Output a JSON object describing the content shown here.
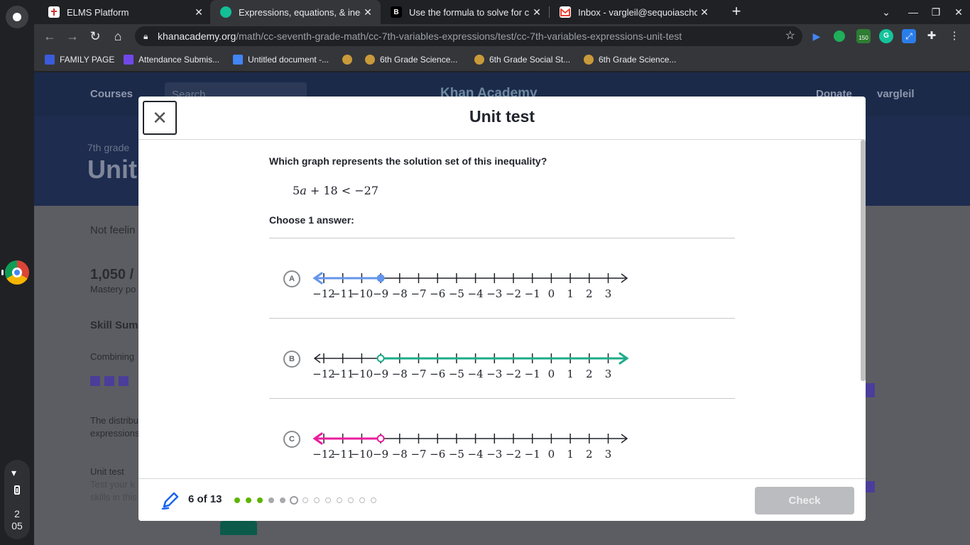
{
  "browser": {
    "tabs": [
      {
        "title": "ELMS Platform",
        "favicon_color": "#ffffff"
      },
      {
        "title": "Expressions, equations, & inequa",
        "favicon_color": "#14bf96"
      },
      {
        "title": "Use the formula to solve for c. Ch",
        "favicon_color": "#000000"
      },
      {
        "title": "Inbox - vargleil@sequoiaschools.",
        "favicon_color": "#ea4335"
      }
    ],
    "new_tab_label": "+",
    "url_host": "khanacademy.org",
    "url_path": "/math/cc-seventh-grade-math/cc-7th-variables-expressions/test/cc-7th-variables-expressions-unit-test",
    "extension_badge": "150",
    "bookmarks": [
      {
        "label": "FAMILY PAGE",
        "icon_color": "#3b5bdb"
      },
      {
        "label": "Attendance Submis...",
        "icon_color": "#7048e8"
      },
      {
        "label": "Untitled document -...",
        "icon_color": "#4285f4"
      },
      {
        "label": "",
        "icon_color": "#c99a3a"
      },
      {
        "label": "6th Grade Science...",
        "icon_color": "#c99a3a"
      },
      {
        "label": "6th Grade Social St...",
        "icon_color": "#c99a3a"
      },
      {
        "label": "6th Grade Science...",
        "icon_color": "#c99a3a"
      }
    ]
  },
  "shelf": {
    "time_hour": "2",
    "time_minute": "05"
  },
  "background_page": {
    "courses": "Courses",
    "search_placeholder": "Search",
    "logo": "Khan Academy",
    "donate": "Donate",
    "user": "vargleil",
    "grade": "7th grade",
    "title_fragment": "Unit",
    "not_feeling": "Not feelin",
    "points": "1,050 /",
    "mastery": "Mastery po",
    "skill_summary": "Skill Summ",
    "combining": "Combining",
    "distrib_1": "The distribu",
    "distrib_2": "expressions",
    "unit_test": "Unit test",
    "test_your_1": "Test your k",
    "test_your_2": "skills in this"
  },
  "modal": {
    "title": "Unit test",
    "question": "Which graph represents the solution set of this inequality?",
    "equation": {
      "lhs_coef": "5",
      "var": "a",
      "rest": " + 18 < −27"
    },
    "choose_label": "Choose 1 answer:",
    "choices": [
      {
        "letter": "A",
        "color": "#6495ed",
        "direction": "left",
        "endpoint": -9,
        "closed": true
      },
      {
        "letter": "B",
        "color": "#1fab89",
        "direction": "right",
        "endpoint": -9,
        "closed": false
      },
      {
        "letter": "C",
        "color": "#e91e9c",
        "direction": "left",
        "endpoint": -9,
        "closed": false
      }
    ],
    "tick_labels": [
      "−12",
      "−11",
      "−10",
      "−9",
      "−8",
      "−7",
      "−6",
      "−5",
      "−4",
      "−3",
      "−2",
      "−1",
      "0",
      "1",
      "2",
      "3"
    ],
    "progress_text": "6 of 13",
    "progress": {
      "total": 13,
      "current": 6,
      "states": [
        "correct",
        "correct",
        "correct",
        "answered",
        "answered",
        "current",
        "todo",
        "todo",
        "todo",
        "todo",
        "todo",
        "todo",
        "todo"
      ]
    },
    "check_label": "Check"
  },
  "colors": {
    "correct": "#5eb400",
    "answered": "#a8a9ac",
    "current": "#9b9ca0",
    "todo": "#b9babd"
  }
}
